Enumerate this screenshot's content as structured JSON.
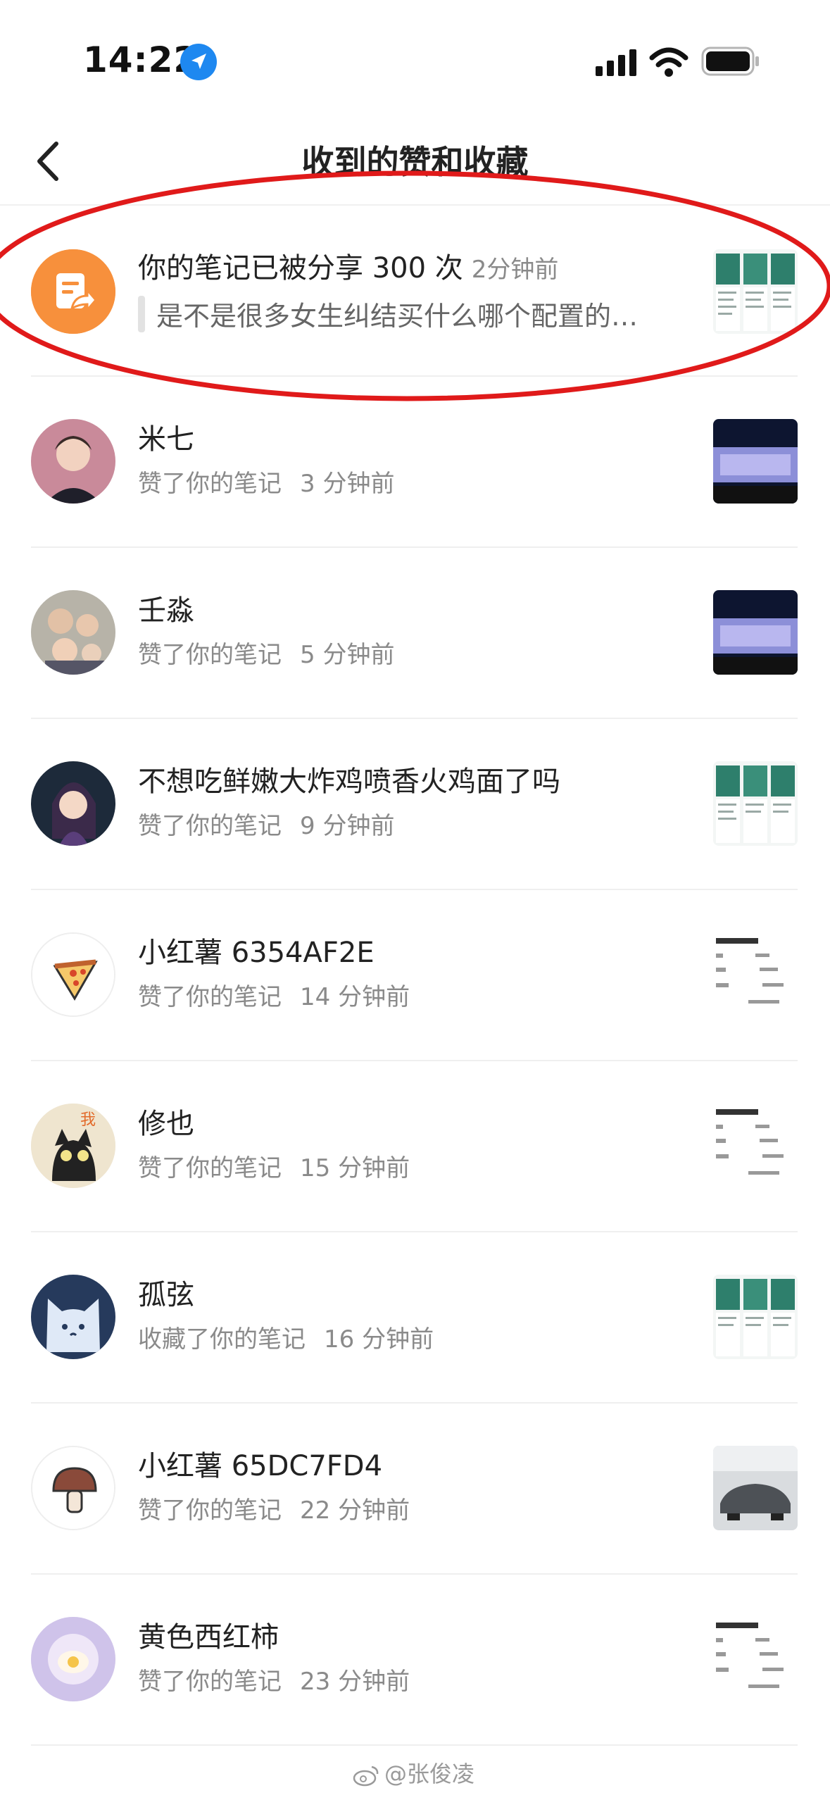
{
  "status_bar": {
    "time": "14:22",
    "icons": [
      "location-arrow-icon",
      "signal-icon",
      "wifi-icon",
      "battery-icon"
    ]
  },
  "header": {
    "title": "收到的赞和收藏",
    "back_icon": "chevron-left-icon"
  },
  "share_notice": {
    "title": "你的笔记已被分享 300 次",
    "time": "2分钟前",
    "quote": "是不是很多女生纠结买什么哪个配置的…",
    "icon": "share-note-icon",
    "icon_color": "#f7903c"
  },
  "items": [
    {
      "name": "米七",
      "action": "赞了你的笔记",
      "time": "3 分钟前",
      "avatar": "person-photo",
      "thumb": "stage-event"
    },
    {
      "name": "壬淼",
      "action": "赞了你的笔记",
      "time": "5 分钟前",
      "avatar": "family-photo",
      "thumb": "stage-event"
    },
    {
      "name": "不想吃鲜嫩大炸鸡喷香火鸡面了吗",
      "action": "赞了你的笔记",
      "time": "9 分钟前",
      "avatar": "anime-girl",
      "thumb": "price-table"
    },
    {
      "name": "小红薯 6354AF2E",
      "action": "赞了你的笔记",
      "time": "14 分钟前",
      "avatar": "pizza-icon",
      "thumb": "text-doc"
    },
    {
      "name": "修也",
      "action": "赞了你的笔记",
      "time": "15 分钟前",
      "avatar": "black-cat",
      "thumb": "text-doc"
    },
    {
      "name": "孤弦",
      "action": "收藏了你的笔记",
      "time": "16 分钟前",
      "avatar": "white-cat",
      "thumb": "price-table"
    },
    {
      "name": "小红薯 65DC7FD4",
      "action": "赞了你的笔记",
      "time": "22 分钟前",
      "avatar": "mushroom-icon",
      "thumb": "car-photo"
    },
    {
      "name": "黄色西红柿",
      "action": "赞了你的笔记",
      "time": "23 分钟前",
      "avatar": "egg-art",
      "thumb": "text-doc"
    }
  ],
  "watermark": "@张俊凌",
  "annotation_color": "#e01a1a"
}
